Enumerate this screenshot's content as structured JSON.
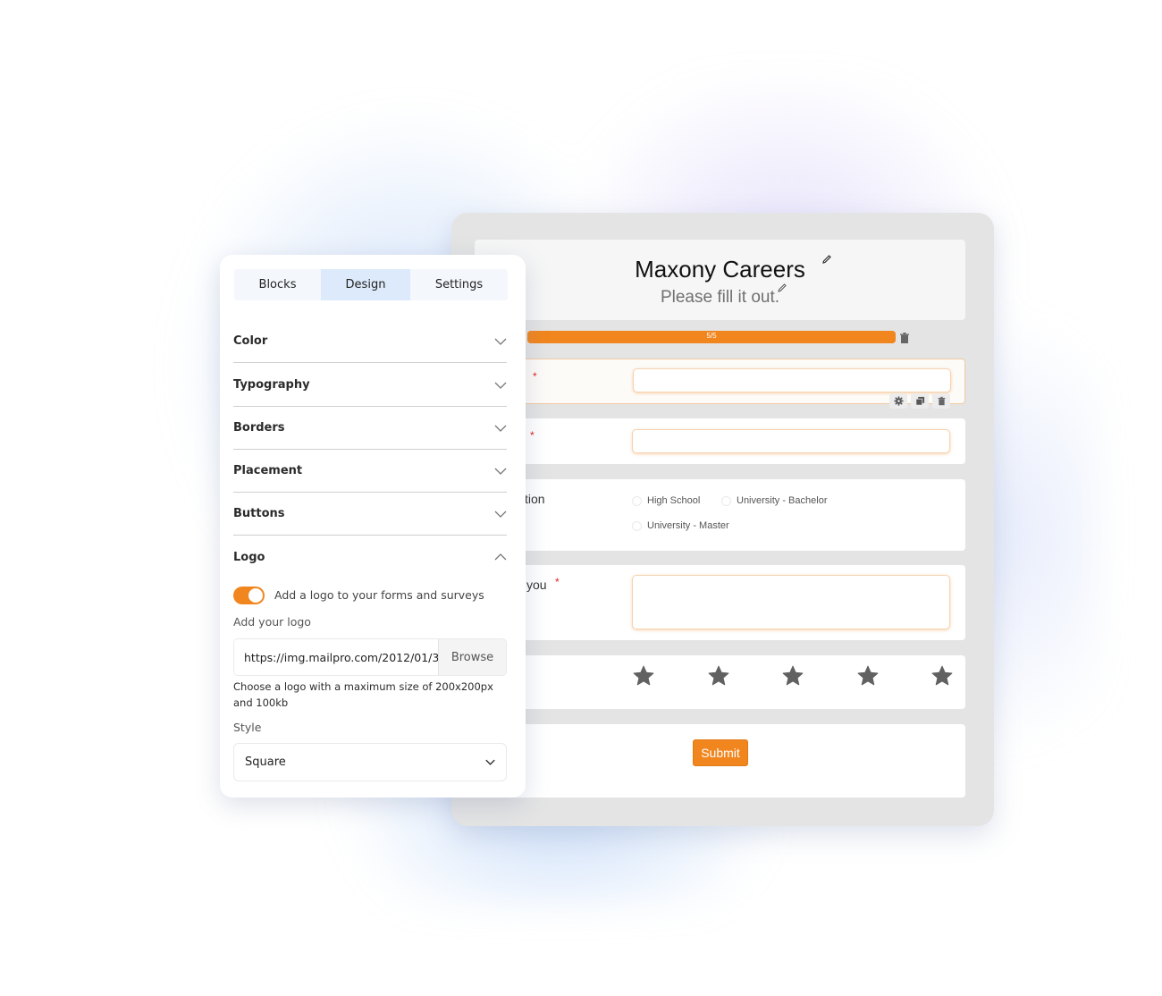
{
  "design_panel": {
    "tabs": [
      {
        "label": "Blocks",
        "active": false
      },
      {
        "label": "Design",
        "active": true
      },
      {
        "label": "Settings",
        "active": false
      }
    ],
    "sections": [
      {
        "label": "Color",
        "expanded": false
      },
      {
        "label": "Typography",
        "expanded": false
      },
      {
        "label": "Borders",
        "expanded": false
      },
      {
        "label": "Placement",
        "expanded": false
      },
      {
        "label": "Buttons",
        "expanded": false
      },
      {
        "label": "Logo",
        "expanded": true
      }
    ],
    "logo": {
      "toggle_on": true,
      "toggle_label": "Add a logo to your forms and surveys",
      "add_logo_label": "Add your logo",
      "url_value": "https://img.mailpro.com/2012/01/3",
      "browse_label": "Browse",
      "hint": "Choose a logo with a maximum size of 200x200px and 100kb",
      "style_label": "Style",
      "style_value": "Square"
    }
  },
  "form_preview": {
    "title": "Maxony Careers",
    "subtitle": "Please fill it out.",
    "progress": {
      "text": "5/5",
      "fraction": 1.0
    },
    "fields": [
      {
        "type": "text",
        "label": "",
        "required": true,
        "selected": true
      },
      {
        "type": "text",
        "label": "",
        "required": true
      },
      {
        "type": "radio",
        "label_fragment": "tion",
        "options": [
          "High School",
          "University - Bachelor",
          "University - Master"
        ]
      },
      {
        "type": "textarea",
        "label_fragment": "you",
        "required": true
      },
      {
        "type": "rating",
        "stars": 5
      }
    ],
    "submit_label": "Submit",
    "required_mark": "*"
  },
  "colors": {
    "accent_orange": "#f1861f",
    "active_tab": "#dceafb",
    "required": "#e02020"
  }
}
